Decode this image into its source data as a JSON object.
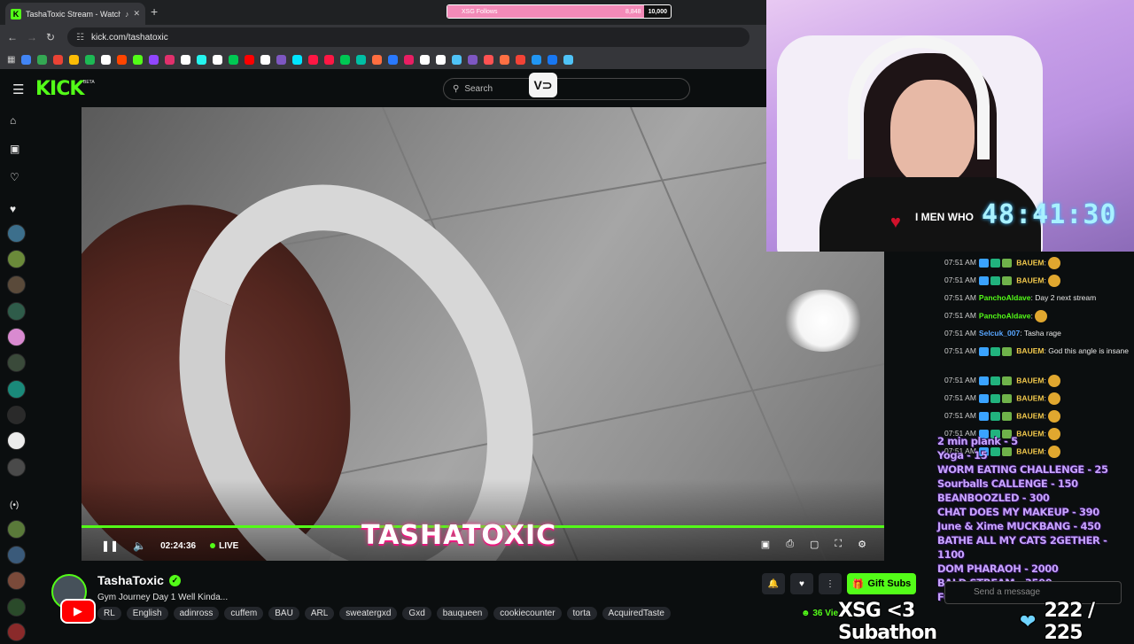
{
  "browser": {
    "tab_title": "TashaToxic Stream - Watch",
    "url": "kick.com/tashatoxic",
    "new_tab": "+",
    "bookmark_colors": [
      "#4285f4",
      "#34a853",
      "#ea4335",
      "#fbbc05",
      "#1db954",
      "#ffffff",
      "#ff4500",
      "#53fc18",
      "#9146ff",
      "#e1306c",
      "#ffffff",
      "#25f4ee",
      "#ffffff",
      "#00c853",
      "#ff0000",
      "#ffffff",
      "#7e57c2",
      "#00e5ff",
      "#ff1744",
      "#ff1744",
      "#00c853",
      "#00bfa5",
      "#ff6e40",
      "#2979ff",
      "#e91e63",
      "#ffffff",
      "#ffffff",
      "#4fc3f7",
      "#7e57c2",
      "#ff5252",
      "#ff7043",
      "#f44336",
      "#2196f3",
      "#1877f2",
      "#4fc3f7"
    ]
  },
  "follow_goal": {
    "label": "XSG Follows",
    "count": "8,848",
    "goal": "10,000",
    "progress": 0.88
  },
  "kick": {
    "logo": "KICK",
    "beta": "BETA",
    "search_placeholder": "Search",
    "vo_label": "V⊃"
  },
  "player": {
    "elapsed": "02:24:36",
    "live": "LIVE",
    "overlay_name": "TASHATOXIC"
  },
  "channel": {
    "name": "TashaToxic",
    "title": "Gym Journey Day 1 Well Kinda...",
    "tags": [
      "RL",
      "English",
      "adinross",
      "cuffem",
      "BAU",
      "ARL",
      "sweatergxd",
      "Gxd",
      "bauqueen",
      "cookiecounter",
      "torta",
      "AcquiredTaste"
    ],
    "gift_label": "Gift Subs",
    "viewers": "36 Vie"
  },
  "webcam": {
    "timer": "48:41:30",
    "shirt_text": "I MEN WHO"
  },
  "chat": {
    "messages": [
      {
        "time": "07:51 AM",
        "user": "BAUEM",
        "text": ""
      },
      {
        "time": "07:51 AM",
        "user": "BAUEM",
        "text": ""
      },
      {
        "time": "07:51 AM",
        "user": "PanchoAldave",
        "text": "Day 2 next stream"
      },
      {
        "time": "07:51 AM",
        "user": "PanchoAldave",
        "text": ""
      },
      {
        "time": "07:51 AM",
        "user": "Selcuk_007",
        "text": "Tasha rage"
      },
      {
        "time": "07:51 AM",
        "user": "BAUEM",
        "text": "God this angle is insane"
      },
      {
        "time": "07:51 AM",
        "user": "BAUEM",
        "text": ""
      },
      {
        "time": "07:51 AM",
        "user": "BAUEM",
        "text": ""
      },
      {
        "time": "07:51 AM",
        "user": "BAUEM",
        "text": ""
      },
      {
        "time": "07:51 AM",
        "user": "BAUEM",
        "text": ""
      },
      {
        "time": "07:51 AM",
        "user": "BAUEM",
        "text": ""
      }
    ],
    "input_placeholder": "Send a message"
  },
  "menu_overlay": [
    "2 min plank - 5",
    "Yoga - 15",
    "WORM EATING CHALLENGE - 25",
    "Sourballs CALLENGE - 150",
    "BEANBOOZLED - 300",
    "CHAT DOES MY MAKEUP - 390",
    "June & Xime MUCKBANG - 450",
    "BATHE ALL MY CATS 2GETHER - 1100",
    "DOM PHARAOH - 2000",
    "BALD STREAM - 3500",
    "Full menu on PINNED CHAT"
  ],
  "subathon": {
    "label": "XSG <3 Subathon",
    "heart": "❤",
    "count": "222 / 225"
  },
  "colors": {
    "kick_green": "#53fc18",
    "background": "#0b0e0f",
    "timer_cyan": "#a8f1ff",
    "menu_purple": "#c7a3ff"
  }
}
